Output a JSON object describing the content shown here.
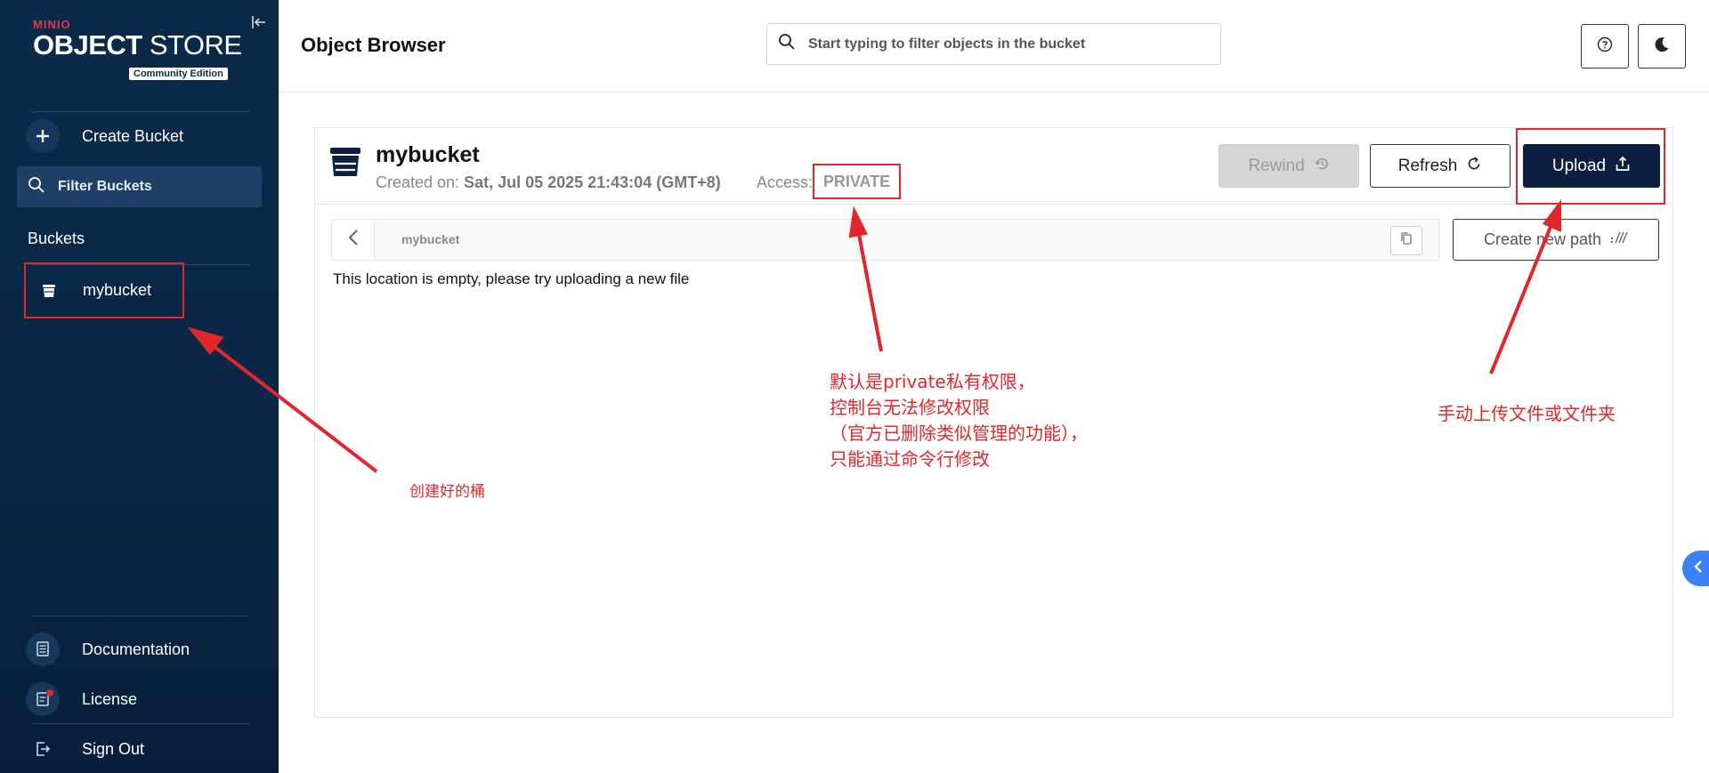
{
  "brand": {
    "minio": "MINIO",
    "object": "OBJECT",
    "store": " STORE",
    "edition": "Community Edition"
  },
  "sidebar": {
    "create_bucket": "Create Bucket",
    "filter_placeholder": "Filter Buckets",
    "buckets_heading": "Buckets",
    "bucket_items": [
      {
        "label": "mybucket"
      }
    ],
    "documentation": "Documentation",
    "license": "License",
    "sign_out": "Sign Out"
  },
  "header": {
    "title": "Object Browser",
    "search_placeholder": "Start typing to filter objects in the bucket"
  },
  "bucket": {
    "name": "mybucket",
    "created_label": "Created on: ",
    "created_value": "Sat, Jul 05 2025 21:43:04 (GMT+8)",
    "access_label": "Access:",
    "access_value": "PRIVATE"
  },
  "toolbar": {
    "rewind": "Rewind",
    "refresh": "Refresh",
    "upload": "Upload",
    "create_new_path": "Create new path"
  },
  "path": {
    "current": "mybucket"
  },
  "empty_message": "This location is empty, please try uploading a new file",
  "annotations": {
    "bucket_note": "创建好的桶",
    "private_note": [
      "默认是private私有权限，",
      "控制台无法修改权限",
      "（官方已删除类似管理的功能），",
      "只能通过命令行修改"
    ],
    "upload_note": "手动上传文件或文件夹"
  },
  "colors": {
    "sidebar_bg": "#0b2a4a",
    "accent_dark": "#0b1f40",
    "annotation_red": "#e1262c",
    "side_tab_blue": "#3b82f6"
  }
}
